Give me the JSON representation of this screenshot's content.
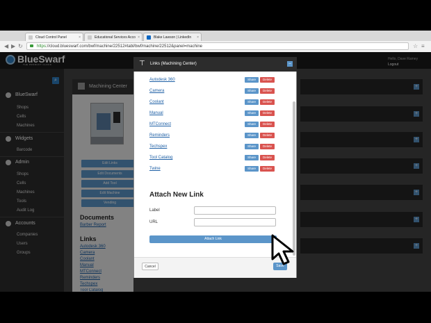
{
  "browser": {
    "tabs": [
      {
        "label": "Cloud Control Panel"
      },
      {
        "label": "Educational Services Acco"
      },
      {
        "label": "Blake Lawson | LinkedIn"
      }
    ],
    "url_scheme": "https",
    "url_rest": "://cloud.blueswarf.com/bwf/machine/22512#tabl/bwf/machine/22512&panel=machine"
  },
  "header": {
    "logo": "BlueSwarf",
    "tagline": "THE PRODUCT CLOUD",
    "user_greeting": "Hello, Dave Ramey",
    "logout": "Logout"
  },
  "sidebar": {
    "sections": [
      {
        "title": "BlueSwarf",
        "items": [
          "Shops",
          "Cells",
          "Machines"
        ]
      },
      {
        "title": "Widgets",
        "items": [
          "Barcode"
        ]
      },
      {
        "title": "Admin",
        "items": [
          "Shops",
          "Cells",
          "Machines",
          "Tools",
          "Audit Log"
        ]
      },
      {
        "title": "Accounts",
        "items": [
          "Companies",
          "Users",
          "Groups"
        ]
      }
    ]
  },
  "left_panel": {
    "title": "Machining Center",
    "buttons": [
      "Edit Links",
      "Edit Documents",
      "Add Tool",
      "Edit Machine",
      "Vending"
    ],
    "documents_heading": "Documents",
    "documents": [
      "Barber Report"
    ],
    "links_heading": "Links",
    "links": [
      "Autodesk 360",
      "Camera",
      "Coolant",
      "Manual",
      "MTConnect",
      "Reminders",
      "Techspex",
      "Tool Catalog"
    ]
  },
  "modal": {
    "title": "Links (Machining Center)",
    "share_label": "Share",
    "delete_label": "Delete",
    "links": [
      "Autodesk 360",
      "Camera",
      "Coolant",
      "Manual",
      "MTConnect",
      "Reminders",
      "Techspex",
      "Tool Catalog",
      "Twine"
    ],
    "attach_heading": "Attach New Link",
    "label_field": "Label",
    "url_field": "URL",
    "attach_button": "Attach Link",
    "cancel": "Cancel",
    "save": "Save"
  },
  "colors": {
    "accent": "#5b95c9",
    "delete": "#d9534f",
    "header_bg": "#1b1b1b"
  }
}
